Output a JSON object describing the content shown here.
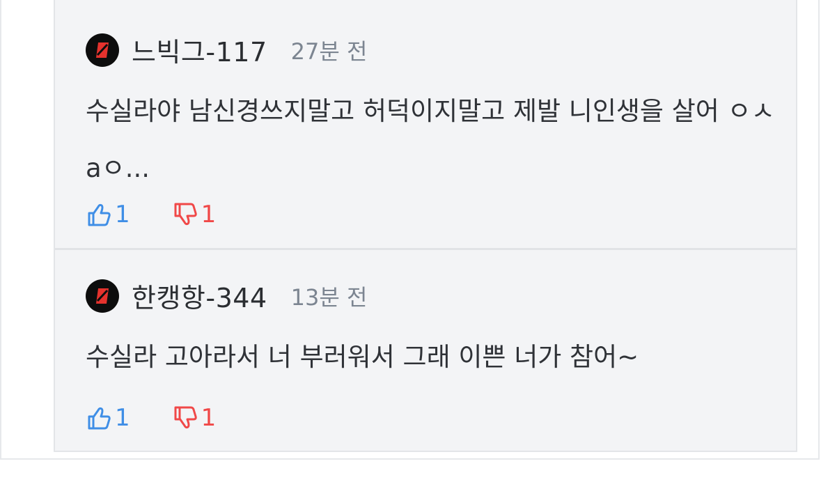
{
  "comments": [
    {
      "username": "느빅그-117",
      "time": "27분 전",
      "text": "수실라야 남신경쓰지말고 허덕이지말고 제발 니인생을 살어 ㅇㅅaㅇ...",
      "likes": "1",
      "dislikes": "1"
    },
    {
      "username": "한캥항-344",
      "time": "13분 전",
      "text": "수실라 고아라서 너 부러워서 그래 이쁜 너가 참어~",
      "likes": "1",
      "dislikes": "1"
    }
  ],
  "colors": {
    "like": "#3f8ee6",
    "dislike": "#f04848",
    "avatar_bg": "#0d0d0d",
    "avatar_mark": "#e5322d"
  },
  "icons": {
    "like": "thumbs-up-icon",
    "dislike": "thumbs-down-icon",
    "avatar": "avatar-logo-icon"
  }
}
